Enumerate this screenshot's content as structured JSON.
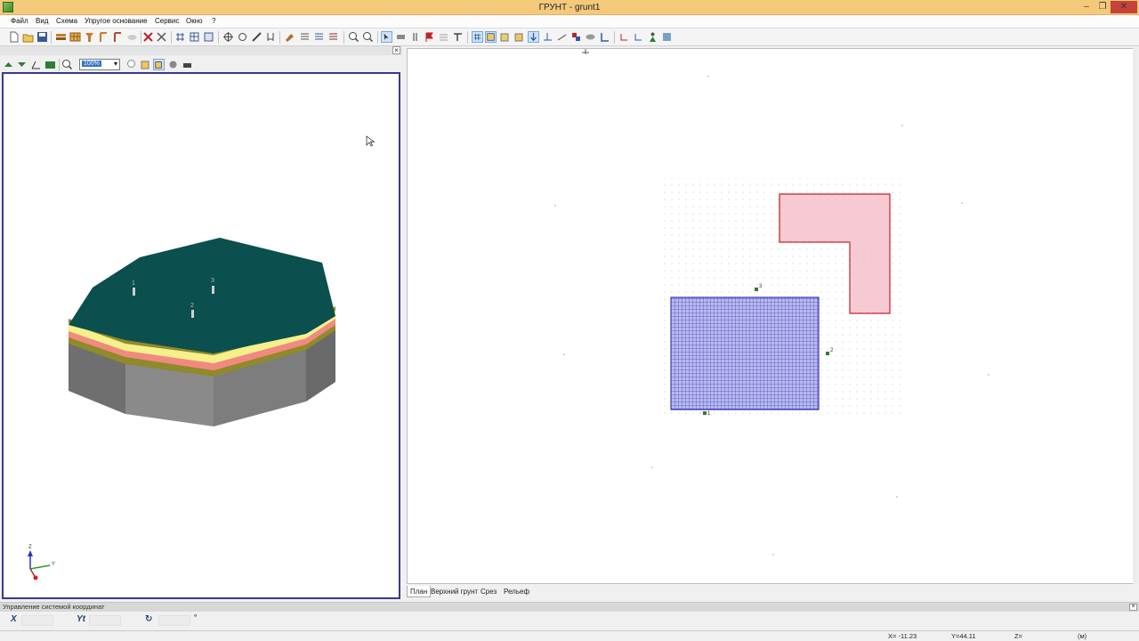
{
  "window": {
    "title": "ГРУНТ - grunt1",
    "minimize": "–",
    "restore": "❐",
    "close": "✕"
  },
  "menu": [
    "Файл",
    "Вид",
    "Схема",
    "Упругое основание",
    "Сервис",
    "Окно",
    "?"
  ],
  "left_panel": {
    "close": "×",
    "zoom_value": "100%",
    "zoom_arrow": "▾",
    "axis_labels": {
      "z": "Z",
      "y": "Y"
    },
    "borehole_labels": [
      "1",
      "2",
      "3"
    ],
    "colors": {
      "top": "#0b4f4f",
      "layer_yellow": "#f5f08a",
      "layer_red": "#f08a80",
      "layer_olive": "#8f8a2a",
      "body": "#7a7a7a"
    }
  },
  "plan": {
    "point_labels": [
      "1",
      "2",
      "3"
    ],
    "colors": {
      "foundation_fill": "#b7b9ee",
      "foundation_grid": "#1a1aa8",
      "l_shape_fill": "#f7c9d2",
      "l_shape_stroke": "#c0202a",
      "point": "#2e7d32"
    }
  },
  "tabs": [
    "План",
    "Верхний грунт",
    "Срез",
    "Рельеф"
  ],
  "coord_panel": {
    "title": "Управление системой координат",
    "close": "×",
    "x_button": "X",
    "yt_button": "Yt",
    "rotate_button": "↻",
    "degree_mark": "°"
  },
  "status": {
    "x": "X= -11.23",
    "y": "Y=44.11",
    "z": "Z=",
    "units": "(м)"
  }
}
